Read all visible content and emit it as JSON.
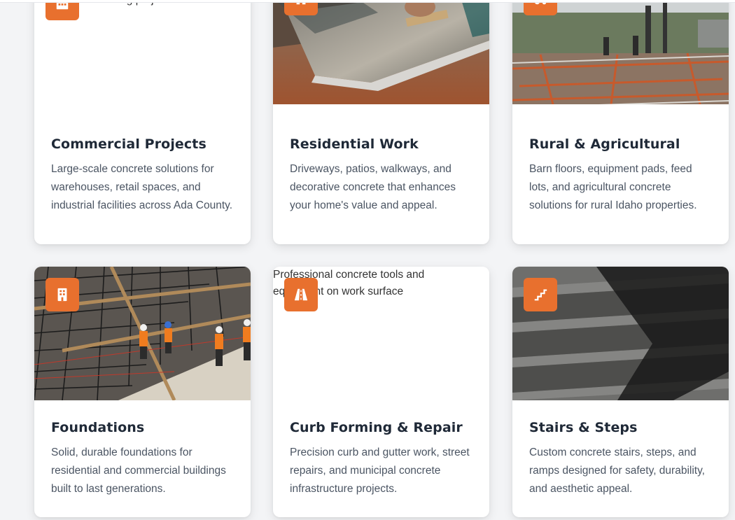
{
  "accent_color": "#e8702e",
  "cards": [
    {
      "title": "Commercial Projects",
      "description": "Large-scale concrete solutions for warehouses, retail spaces, and industrial facilities across Ada County.",
      "icon": "building-icon",
      "image_alt": "Commercial building project"
    },
    {
      "title": "Residential Work",
      "description": "Driveways, patios, walkways, and decorative concrete that enhances your home's value and appeal.",
      "icon": "home-icon"
    },
    {
      "title": "Rural & Agricultural",
      "description": "Barn floors, equipment pads, feed lots, and agricultural concrete solutions for rural Idaho properties.",
      "icon": "tractor-icon"
    },
    {
      "title": "Foundations",
      "description": "Solid, durable foundations for residential and commercial buildings built to last generations.",
      "icon": "building-icon"
    },
    {
      "title": "Curb Forming & Repair",
      "description": "Precision curb and gutter work, street repairs, and municipal concrete infrastructure projects.",
      "icon": "road-icon",
      "image_alt": "Professional concrete tools and equipment on work surface"
    },
    {
      "title": "Stairs & Steps",
      "description": "Custom concrete stairs, steps, and ramps designed for safety, durability, and aesthetic appeal.",
      "icon": "stairs-icon"
    }
  ]
}
